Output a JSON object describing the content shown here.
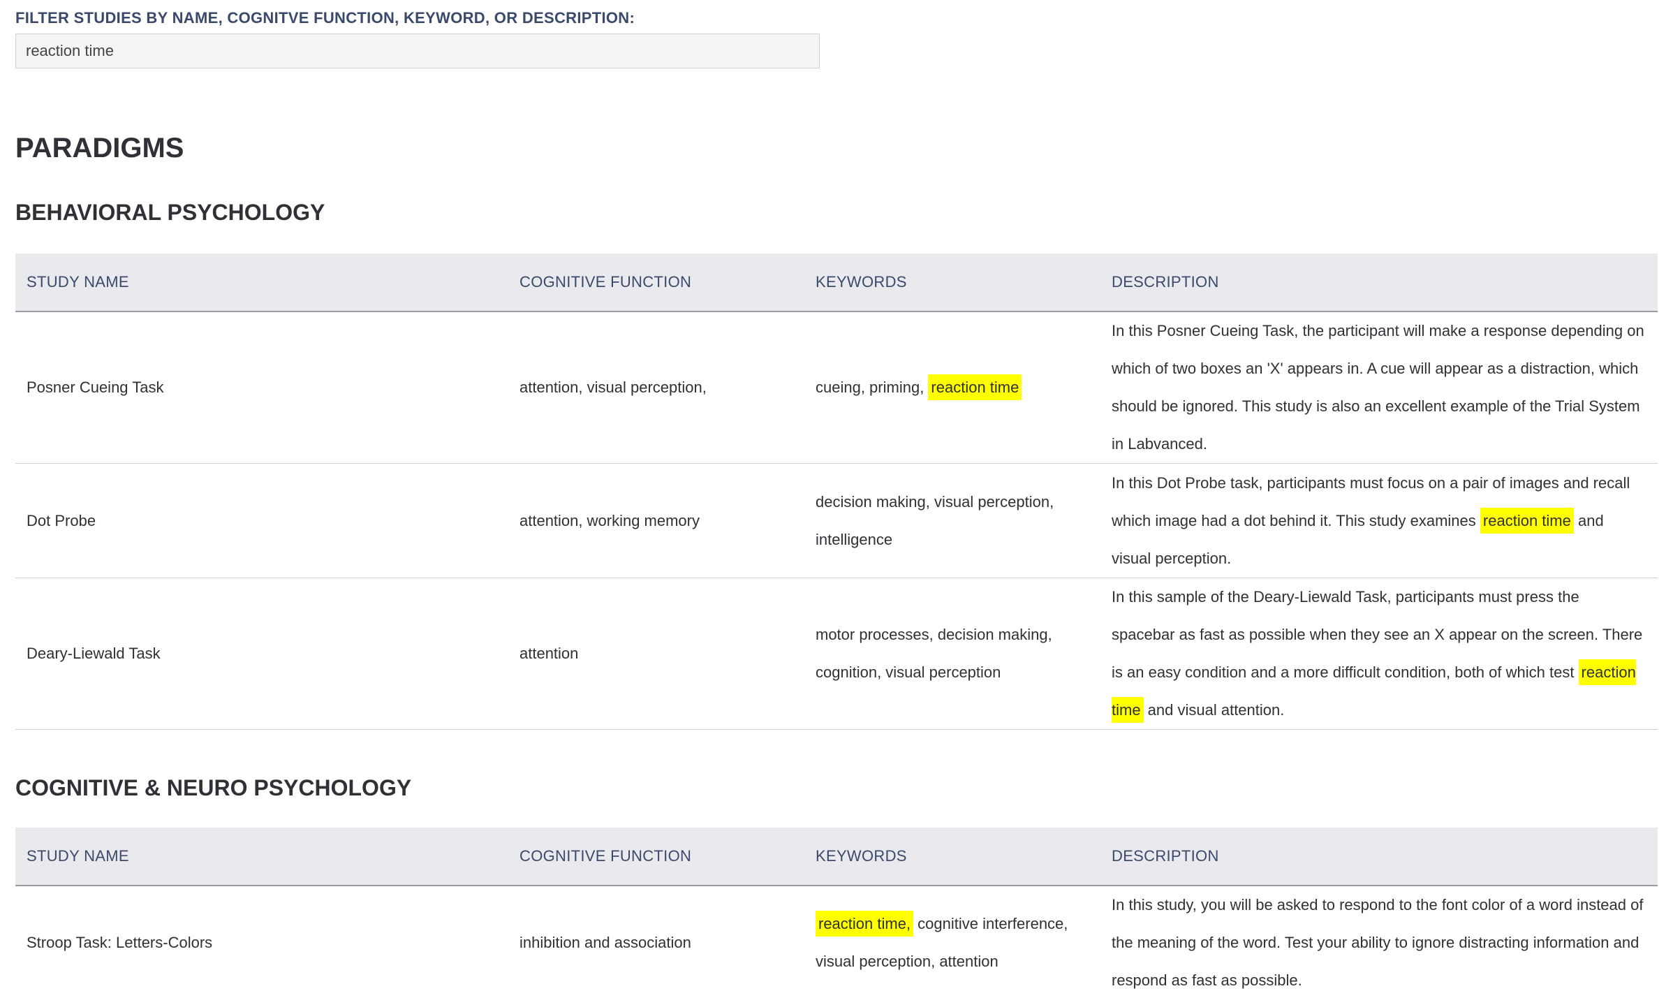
{
  "filter": {
    "label": "FILTER STUDIES BY NAME, COGNITVE FUNCTION, KEYWORD, OR DESCRIPTION:",
    "value": "reaction time"
  },
  "page_title": "PARADIGMS",
  "columns": {
    "study_name": "STUDY NAME",
    "cognitive_function": "COGNITIVE FUNCTION",
    "keywords": "KEYWORDS",
    "description": "DESCRIPTION"
  },
  "sections": [
    {
      "title": "BEHAVIORAL PSYCHOLOGY",
      "rows": [
        {
          "name": "Posner Cueing Task",
          "cognitive_function": "attention, visual perception,",
          "keywords": {
            "before": "cueing, priming, ",
            "highlight": "reaction time",
            "after": ""
          },
          "description": {
            "before": "In this Posner Cueing Task, the participant will make a response depending on which of two boxes an 'X' appears in. A cue will appear as a distraction, which should be ignored. This study is also an excellent example of the Trial System in Labvanced.",
            "highlight": "",
            "after": ""
          }
        },
        {
          "name": "Dot Probe",
          "cognitive_function": "attention, working memory",
          "keywords": {
            "before": "decision making, visual perception, intelligence",
            "highlight": "",
            "after": ""
          },
          "description": {
            "before": "In this Dot Probe task, participants must focus on a pair of images and recall which image had a dot behind it. This study examines ",
            "highlight": "reaction time",
            "after": " and visual perception."
          }
        },
        {
          "name": "Deary-Liewald Task",
          "cognitive_function": "attention",
          "keywords": {
            "before": "motor processes, decision making, cognition, visual perception",
            "highlight": "",
            "after": ""
          },
          "description": {
            "before": "In this sample of the Deary-Liewald Task, participants must press the spacebar as fast as possible when they see an X appear on the screen. There is an easy condition and a more difficult condition, both of which test ",
            "highlight": "reaction time",
            "after": " and visual attention."
          }
        }
      ]
    },
    {
      "title": "COGNITIVE & NEURO PSYCHOLOGY",
      "rows": [
        {
          "name": "Stroop Task: Letters-Colors",
          "cognitive_function": "inhibition and association",
          "keywords": {
            "before": "",
            "highlight": "reaction time,",
            "after": " cognitive interference, visual perception, attention"
          },
          "description": {
            "before": "In this study, you will be asked to respond to the font color of a word instead of the meaning of the word. Test your ability to ignore distracting information and respond as fast as possible.",
            "highlight": "",
            "after": ""
          }
        }
      ]
    }
  ],
  "colors": {
    "highlight": "#ffff00",
    "header_bg": "#e9e9ee",
    "label": "#3a4a6b"
  }
}
